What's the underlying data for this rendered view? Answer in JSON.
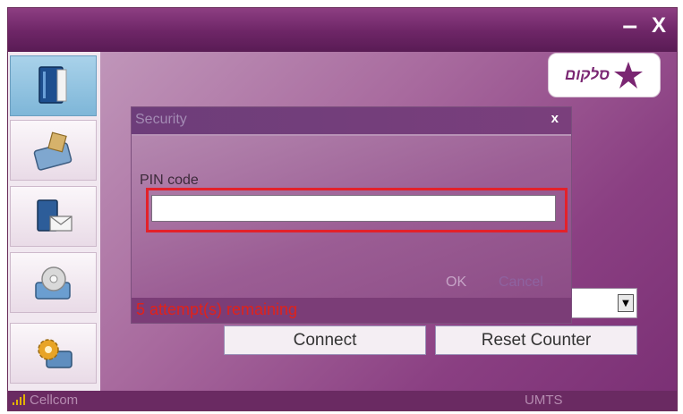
{
  "titlebar": {
    "minimize_label": "–",
    "close_label": "X"
  },
  "logo": {
    "text": "סלקום",
    "accent": "#7a2672"
  },
  "sidebar": {
    "items": [
      {
        "icon": "phonebook-icon",
        "active": true
      },
      {
        "icon": "sim-card-icon",
        "active": false
      },
      {
        "icon": "messages-icon",
        "active": false
      },
      {
        "icon": "disk-icon",
        "active": false
      },
      {
        "icon": "settings-gear-icon",
        "active": false
      }
    ]
  },
  "dialog": {
    "title": "Security",
    "close_label": "x",
    "pin_label": "PIN code",
    "pin_value": "",
    "ok_label": "OK",
    "cancel_label": "Cancel",
    "attempts_text": "5 attempt(s) remaining"
  },
  "main": {
    "connect_label": "Connect",
    "reset_label": "Reset Counter",
    "combo_value": ""
  },
  "status": {
    "carrier": "Cellcom",
    "network": "UMTS"
  },
  "colors": {
    "frame": "#6e2667",
    "error": "#e1221a",
    "highlight": "#e3212a"
  }
}
